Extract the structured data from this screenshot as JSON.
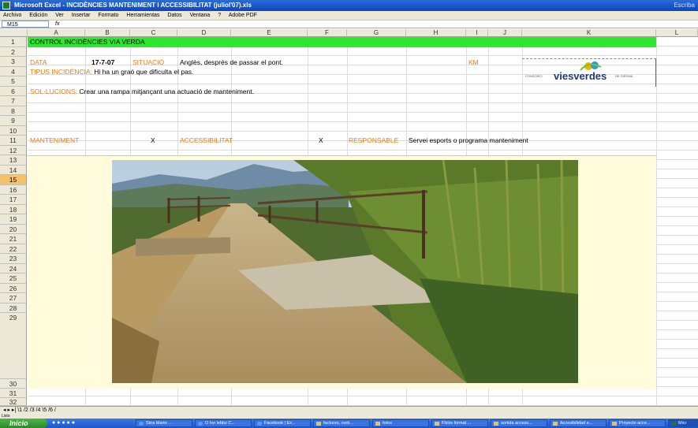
{
  "window": {
    "title": "Microsoft Excel - INCIDÈNCIES MANTENIMENT I ACCESSIBILITAT (juliol'07).xls",
    "side_text": "Escriba"
  },
  "menu": [
    "Archivo",
    "Edición",
    "Ver",
    "Insertar",
    "Formato",
    "Herramientas",
    "Datos",
    "Ventana",
    "?",
    "Adobe PDF"
  ],
  "formula": {
    "name_box": "M15",
    "fx": "fx"
  },
  "columns": [
    "A",
    "B",
    "C",
    "D",
    "E",
    "F",
    "G",
    "H",
    "I",
    "J",
    "K",
    "L"
  ],
  "rows": [
    "1",
    "2",
    "3",
    "4",
    "5",
    "6",
    "7",
    "8",
    "9",
    "10",
    "11",
    "12",
    "13",
    "14",
    "15",
    "16",
    "17",
    "18",
    "19",
    "20",
    "21",
    "22",
    "23",
    "24",
    "25",
    "26",
    "27",
    "28",
    "29",
    "30",
    "31",
    "32"
  ],
  "selected_row": "15",
  "sheet": {
    "title": "CONTROL INCIDÈNCIES VIA VERDA",
    "data_label": "DATA",
    "date": "17-7-07",
    "situacio_label": "SITUACIÓ",
    "situacio": "Anglès, després de passar el pont.",
    "km_label": "KM",
    "tipus_label": "TIPUS INCIDÈNCIA:",
    "tipus": "Hi ha un graó que dificulta el pas.",
    "solucions_label": "SOL·LUCIONS:",
    "solucions": "Crear una rampa mitjançant una actuació de manteniment.",
    "manteniment_label": "MANTENIMENT",
    "manteniment_mark": "X",
    "accessibilitat_label": "ACCESSIBILITAT",
    "accessibilitat_mark": "X",
    "responsable_label": "RESPONSABLE",
    "responsable": "Servei esports o programa manteniment"
  },
  "logo": {
    "prefix": "CONSORCI",
    "name": "viesverdes",
    "suffix": "DE GIRONA"
  },
  "sheet_tabs": "\\1 /2 /3 /4 \\5 /6 /",
  "status": "Listo",
  "taskbar": {
    "start": "Inicio",
    "buttons": [
      "Skra Marto ...",
      "O Ivo lebbz C...",
      "Facebook | Ex...",
      "factures, certi...",
      "fotos",
      "Flicks format ...",
      "sortida access...",
      "Accesibilidad e...",
      "Proyecto acce...",
      "Micr"
    ]
  }
}
